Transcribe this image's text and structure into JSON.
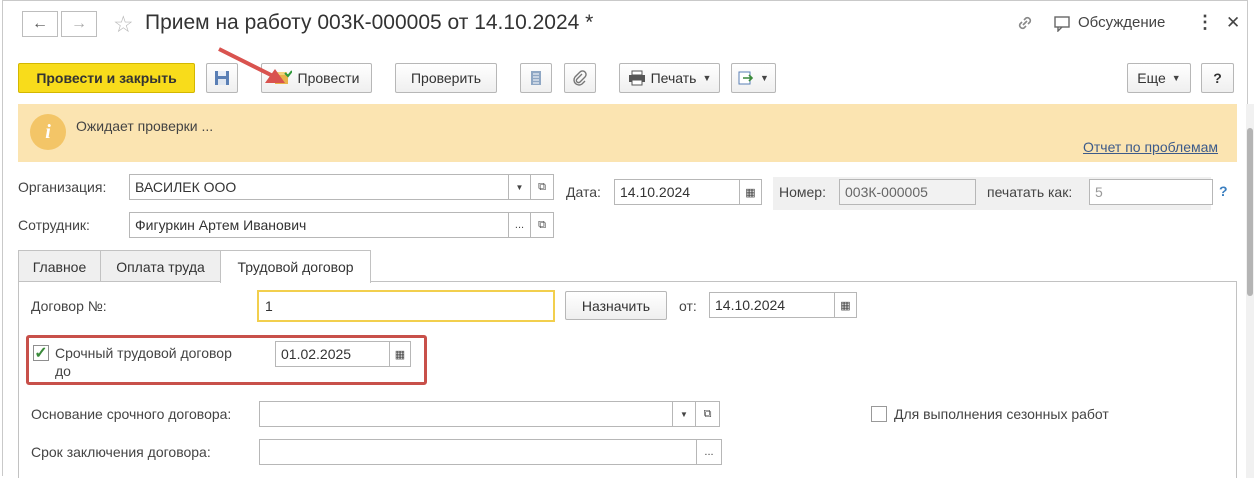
{
  "window": {
    "title": "Прием на работу 003К-000005 от 14.10.2024 *",
    "back_icon": "←",
    "forward_icon": "→",
    "favorite_icon": "☆",
    "link_icon": "🔗",
    "discussion_label": "Обсуждение",
    "more_icon": "⋮",
    "close_icon": "✕"
  },
  "toolbar": {
    "post_and_close": "Провести и закрыть",
    "post": "Провести",
    "check": "Проверить",
    "print": "Печать",
    "more": "Еще",
    "help": "?"
  },
  "message": {
    "text": "Ожидает проверки ...",
    "link": "Отчет по проблемам"
  },
  "form": {
    "org_label": "Организация:",
    "org_value": "ВАСИЛЕК ООО",
    "employee_label": "Сотрудник:",
    "employee_value": "Фигуркин Артем Иванович",
    "date_label": "Дата:",
    "date_value": "14.10.2024",
    "number_label": "Номер:",
    "number_value": "003К-000005",
    "print_as_label": "печатать как:",
    "print_as_placeholder": "5",
    "help_mark": "?"
  },
  "tabs": [
    {
      "label": "Главное"
    },
    {
      "label": "Оплата труда"
    },
    {
      "label": "Трудовой договор"
    }
  ],
  "contract": {
    "number_label": "Договор №:",
    "number_value": "1",
    "assign_button": "Назначить",
    "from_label": "от:",
    "from_date": "14.10.2024",
    "fixed_term_checked": true,
    "fixed_term_label_1": "Срочный трудовой договор",
    "fixed_term_label_2": "до",
    "fixed_term_date": "01.02.2025",
    "basis_label": "Основание срочного договора:",
    "basis_value": "",
    "seasonal_label": "Для выполнения сезонных работ",
    "seasonal_checked": false,
    "term_label": "Срок заключения договора:",
    "term_value": ""
  }
}
